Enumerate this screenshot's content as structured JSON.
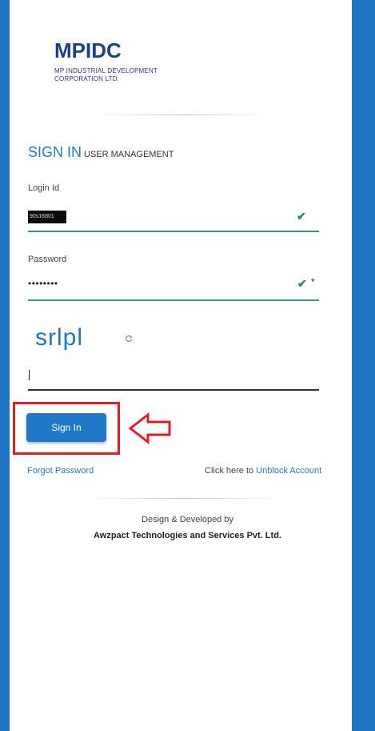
{
  "brand": {
    "logo_text": "MPIDC",
    "name_line1": "MP INDUSTRIAL DEVELOPMENT",
    "name_line2": "CORPORATION LTD.",
    "color": "#1d3f8a"
  },
  "heading": {
    "title": "SIGN IN",
    "subtitle": "USER MANAGEMENT"
  },
  "form": {
    "login_label": "Login Id",
    "login_value": "90s16801",
    "password_label": "Password",
    "password_value": "••••••••",
    "password_required": "*",
    "captcha_text": "srlpl",
    "captcha_value": ""
  },
  "actions": {
    "sign_in_label": "Sign In"
  },
  "links": {
    "forgot_password": "Forgot Password",
    "unblock_prefix": "Click here to",
    "unblock_link": "Unblock Account"
  },
  "footer": {
    "line1": "Design & Developed by",
    "line2": "Awzpact Technologies and Services Pvt. Ltd."
  },
  "icons": [
    "check-icon",
    "refresh-icon",
    "arrow-left-icon"
  ],
  "colors": {
    "accent": "#1f74c4",
    "success": "#2f9f68",
    "highlight": "#e01d25"
  }
}
